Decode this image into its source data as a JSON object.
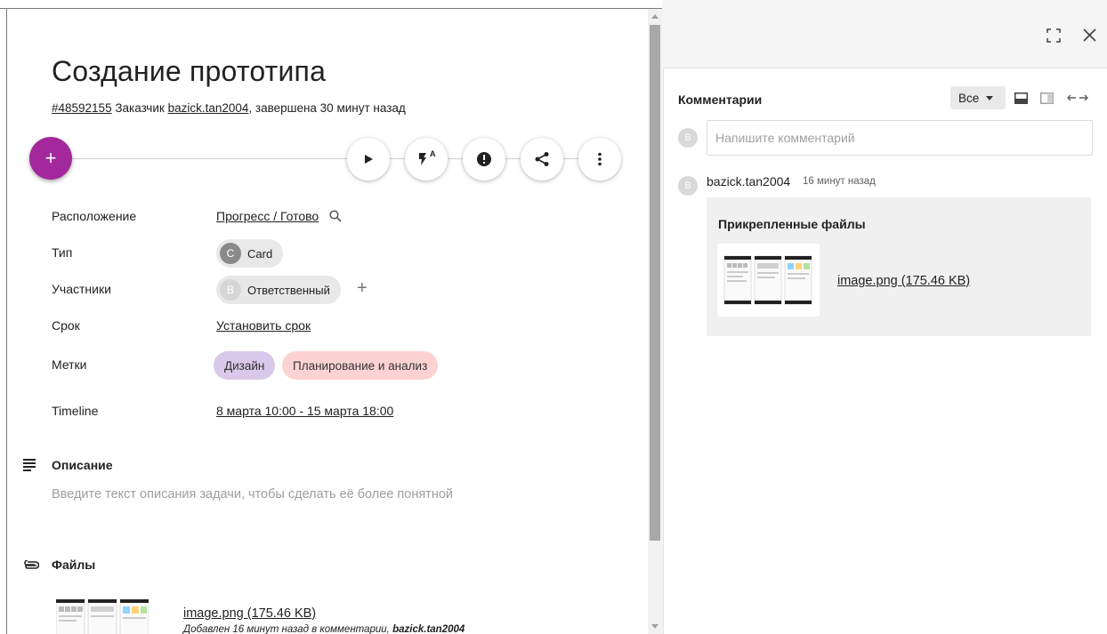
{
  "task": {
    "title": "Создание прототипа",
    "id_link": "#48592155",
    "customer_prefix": "Заказчик",
    "customer_link": "bazick.tan2004",
    "completed_text": ", завершена 30 минут назад"
  },
  "toolbar": {
    "add_label": "+",
    "auto_label": "A"
  },
  "fields": {
    "location": {
      "label": "Расположение",
      "value": "Прогресс / Готово"
    },
    "type": {
      "label": "Тип",
      "avatar": "C",
      "value": "Card"
    },
    "participants": {
      "label": "Участники",
      "avatar": "B",
      "value": "Ответственный",
      "add": "+"
    },
    "deadline": {
      "label": "Срок",
      "value": "Установить срок"
    },
    "tags": {
      "label": "Метки",
      "items": [
        "Дизайн",
        "Планирование и анализ"
      ]
    },
    "timeline": {
      "label": "Timeline",
      "value": "8 марта 10:00 - 15 марта 18:00"
    }
  },
  "description": {
    "title": "Описание",
    "placeholder": "Введите текст описания задачи, чтобы сделать её более понятной"
  },
  "files": {
    "title": "Файлы",
    "name": "image.png (175.46 KB)",
    "meta_prefix": "Добавлен 16 минут назад в комментарии,",
    "meta_author": "bazick.tan2004"
  },
  "comments": {
    "title": "Комментарии",
    "filter": "Все",
    "input_avatar": "B",
    "placeholder": "Напишите комментарий",
    "entry": {
      "avatar": "B",
      "author": "bazick.tan2004",
      "time": "16 минут назад",
      "attach_title": "Прикрепленные файлы",
      "file_name": "image.png (175.46 KB)"
    }
  },
  "colors": {
    "fab": "#a2289c",
    "tag_design": "#d9c8ea",
    "tag_planning": "#fdd2d2",
    "type_avatar": "#8a8a8a"
  },
  "icons": {
    "fullscreen": "fullscreen-icon",
    "close": "close-icon",
    "play": "play-icon",
    "auto": "auto-flash-icon",
    "alert": "alert-icon",
    "share": "share-icon",
    "more": "more-vertical-icon",
    "search": "search-icon",
    "description": "notes-icon",
    "attachment": "paperclip-icon"
  }
}
